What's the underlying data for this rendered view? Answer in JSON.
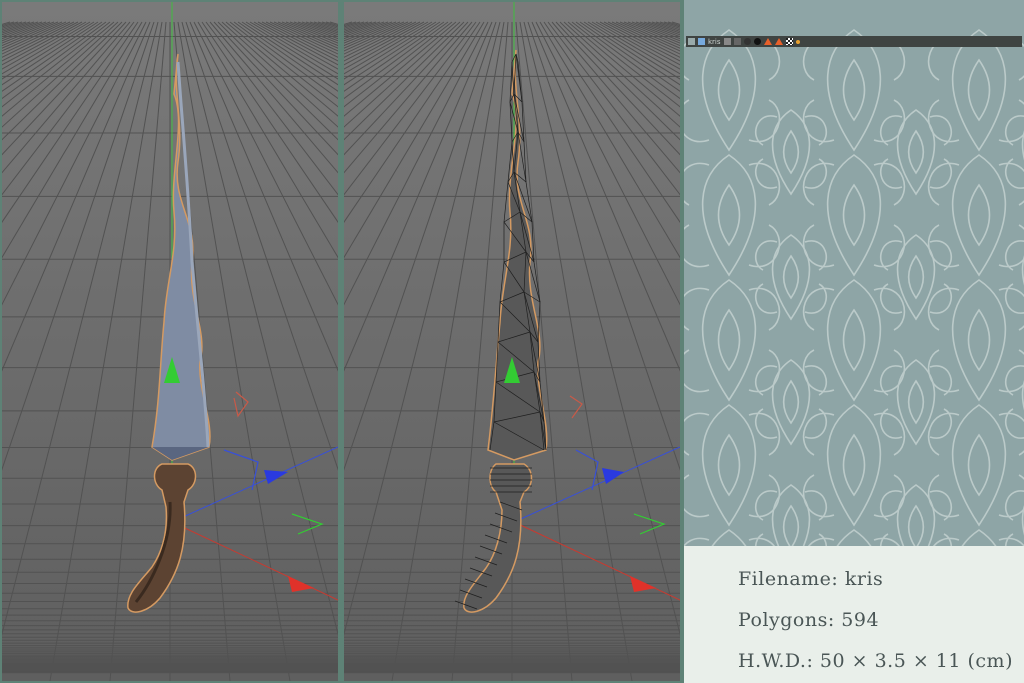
{
  "viewports": [
    {
      "name": "perspective-shaded",
      "shading": "gouraud"
    },
    {
      "name": "perspective-wireframe",
      "shading": "wireframe"
    }
  ],
  "object_manager": {
    "object_name": "kris",
    "icons": [
      "layer-icon",
      "object-icon",
      "tag-icon",
      "material-icon",
      "sphere-icon",
      "cone-icon",
      "cone-icon",
      "checker-icon",
      "dot-icon"
    ]
  },
  "info": {
    "filename_label": "Filename: kris",
    "polygons_label": "Polygons: 594",
    "dimensions_label": "H.W.D.: 50 × 3.5 × 11 (cm)"
  },
  "colors": {
    "frame": "#5e8276",
    "viewport_bg": "#6b6b6b",
    "blade": "#7c8aa1",
    "handle": "#5a4030",
    "outline": "#d49a62",
    "axis_x": "#e0322a",
    "axis_y": "#33cc33",
    "axis_z": "#2a3ae0",
    "wallpaper": "#8ea5a6",
    "info_bg": "#e9efea"
  }
}
